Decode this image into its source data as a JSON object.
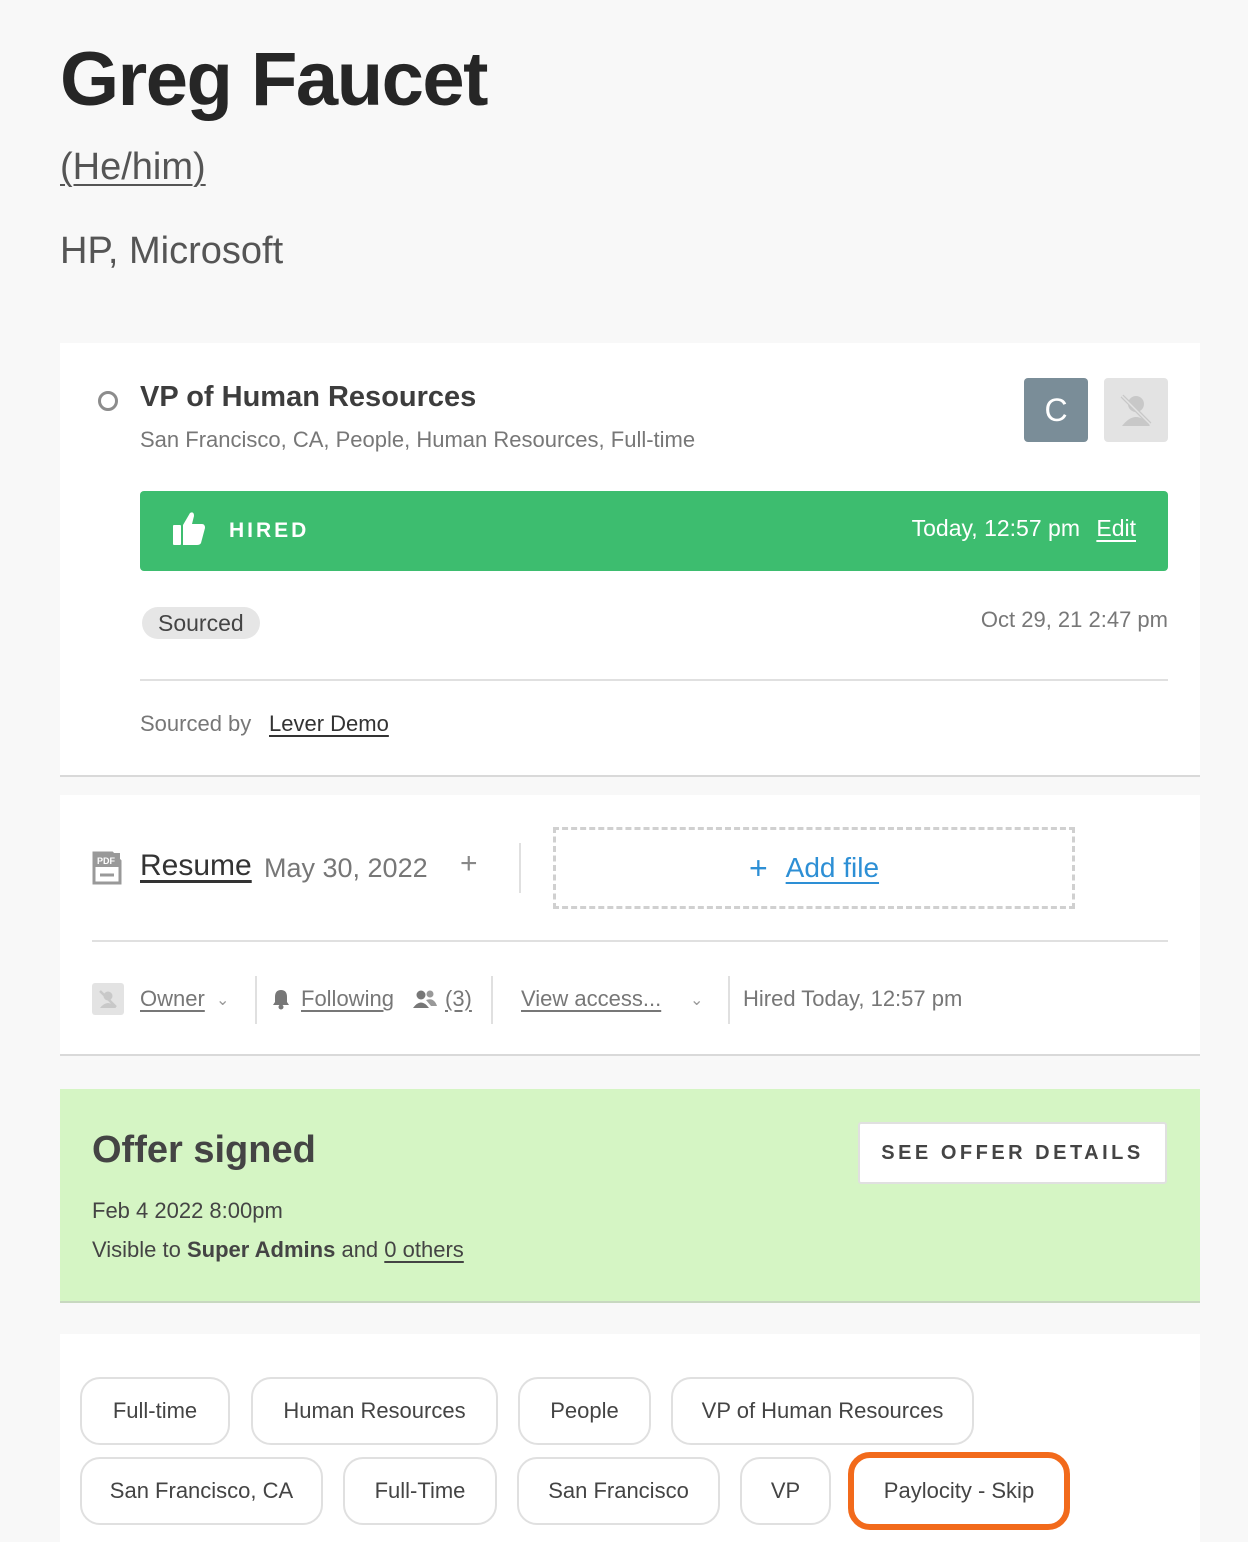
{
  "candidate": {
    "name": "Greg Faucet",
    "pronouns": "(He/him)",
    "companies": "HP, Microsoft"
  },
  "opportunity": {
    "job_title": "VP of Human Resources",
    "job_details": "San Francisco, CA, People, Human Resources, Full-time",
    "avatar_initial": "C",
    "status": {
      "label": "HIRED",
      "time": "Today, 12:57 pm",
      "edit_label": "Edit",
      "color": "#3dbd6f"
    },
    "source_tag": "Sourced",
    "source_date": "Oct 29, 21 2:47 pm",
    "sourced_by_label": "Sourced by",
    "sourced_by_name": "Lever Demo"
  },
  "files": {
    "resume_label": "Resume",
    "resume_date": "May 30, 2022",
    "add_file_label": "Add file"
  },
  "meta": {
    "owner_label": "Owner",
    "following_label": "Following",
    "followers_count": "(3)",
    "view_access_label": "View access...",
    "hired_text": "Hired Today, 12:57 pm"
  },
  "offer": {
    "title": "Offer signed",
    "button_label": "SEE OFFER DETAILS",
    "date": "Feb 4 2022 8:00pm",
    "visible_prefix": "Visible to",
    "visible_group": "Super Admins",
    "visible_and": "and",
    "visible_others": "0 others",
    "background": "#d5f5c4"
  },
  "tags": [
    "Full-time",
    "Human Resources",
    "People",
    "VP of Human Resources",
    "San Francisco, CA",
    "Full-Time",
    "San Francisco",
    "VP",
    "Paylocity - Skip"
  ],
  "highlight_color": "#f26a1b"
}
